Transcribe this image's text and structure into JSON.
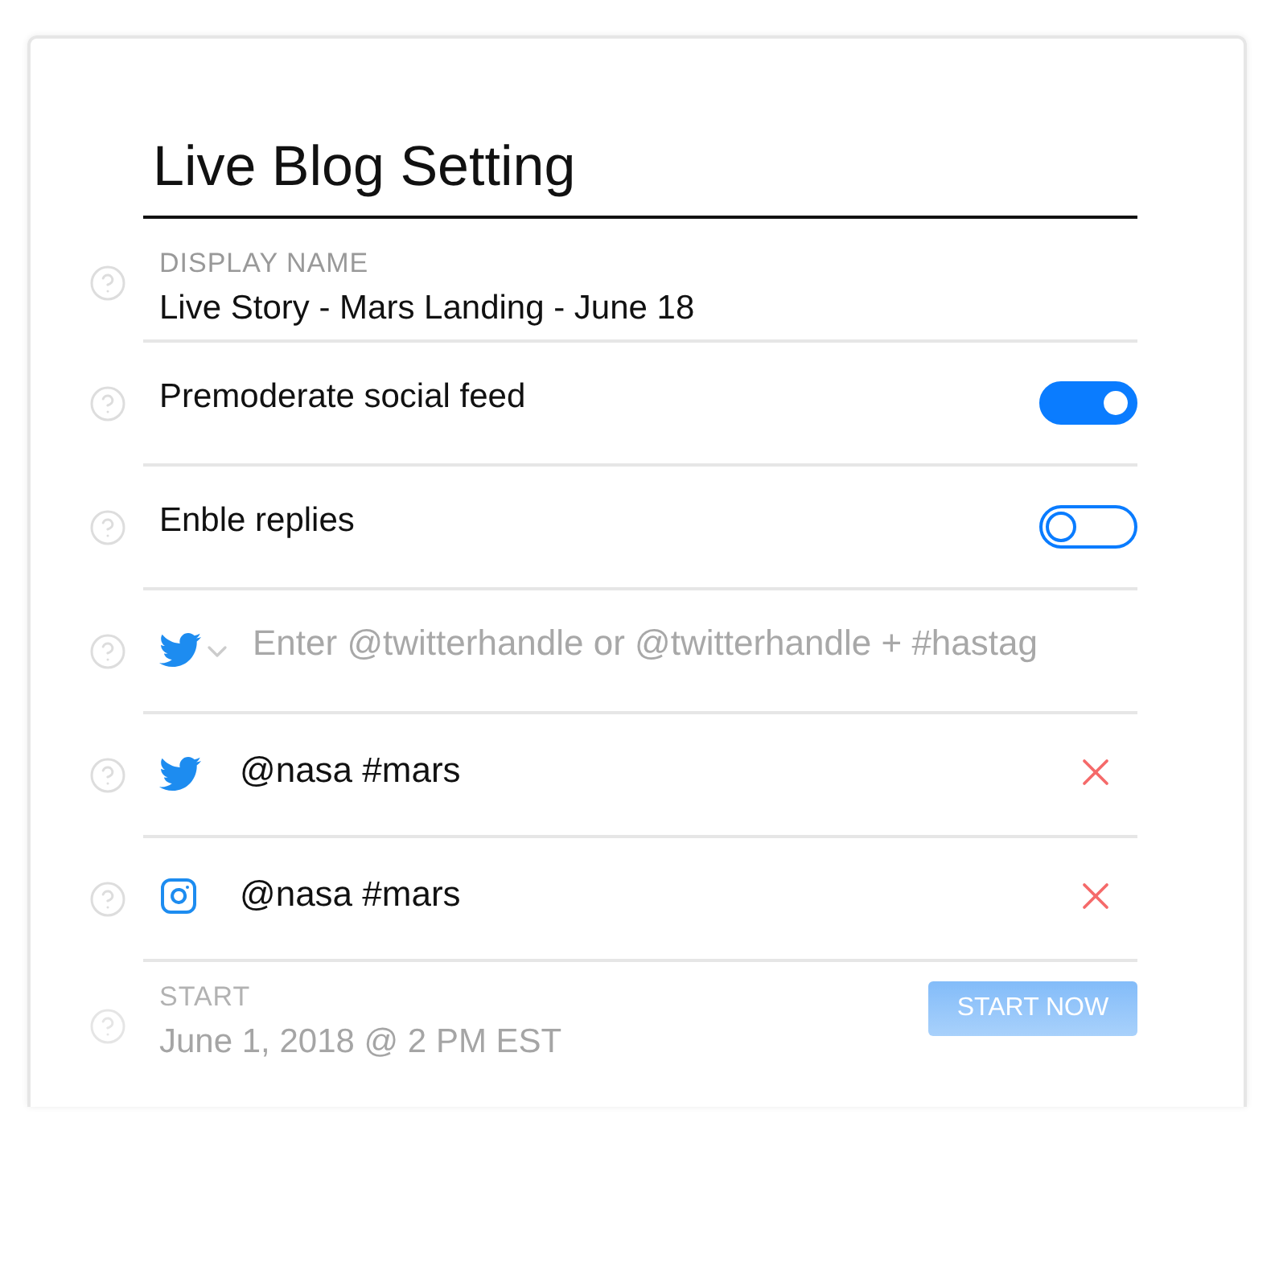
{
  "title": "Live Blog Setting",
  "rows": [
    {
      "kind": "field",
      "label": "DISPLAY NAME",
      "value": "Live Story - Mars Landing - June 18"
    },
    {
      "kind": "toggle",
      "label": "Premoderate social feed",
      "on": true
    },
    {
      "kind": "toggle",
      "label": "Enble replies",
      "on": false
    },
    {
      "kind": "twitter-input",
      "placeholder": "Enter @twitterhandle or @twitterhandle + #hastag"
    },
    {
      "kind": "twitter",
      "value": "@nasa #mars"
    },
    {
      "kind": "instagram",
      "value": "@nasa #mars"
    },
    {
      "kind": "start",
      "label": "START",
      "value": "June 1, 2018 @ 2 PM EST",
      "button": "START NOW"
    }
  ]
}
